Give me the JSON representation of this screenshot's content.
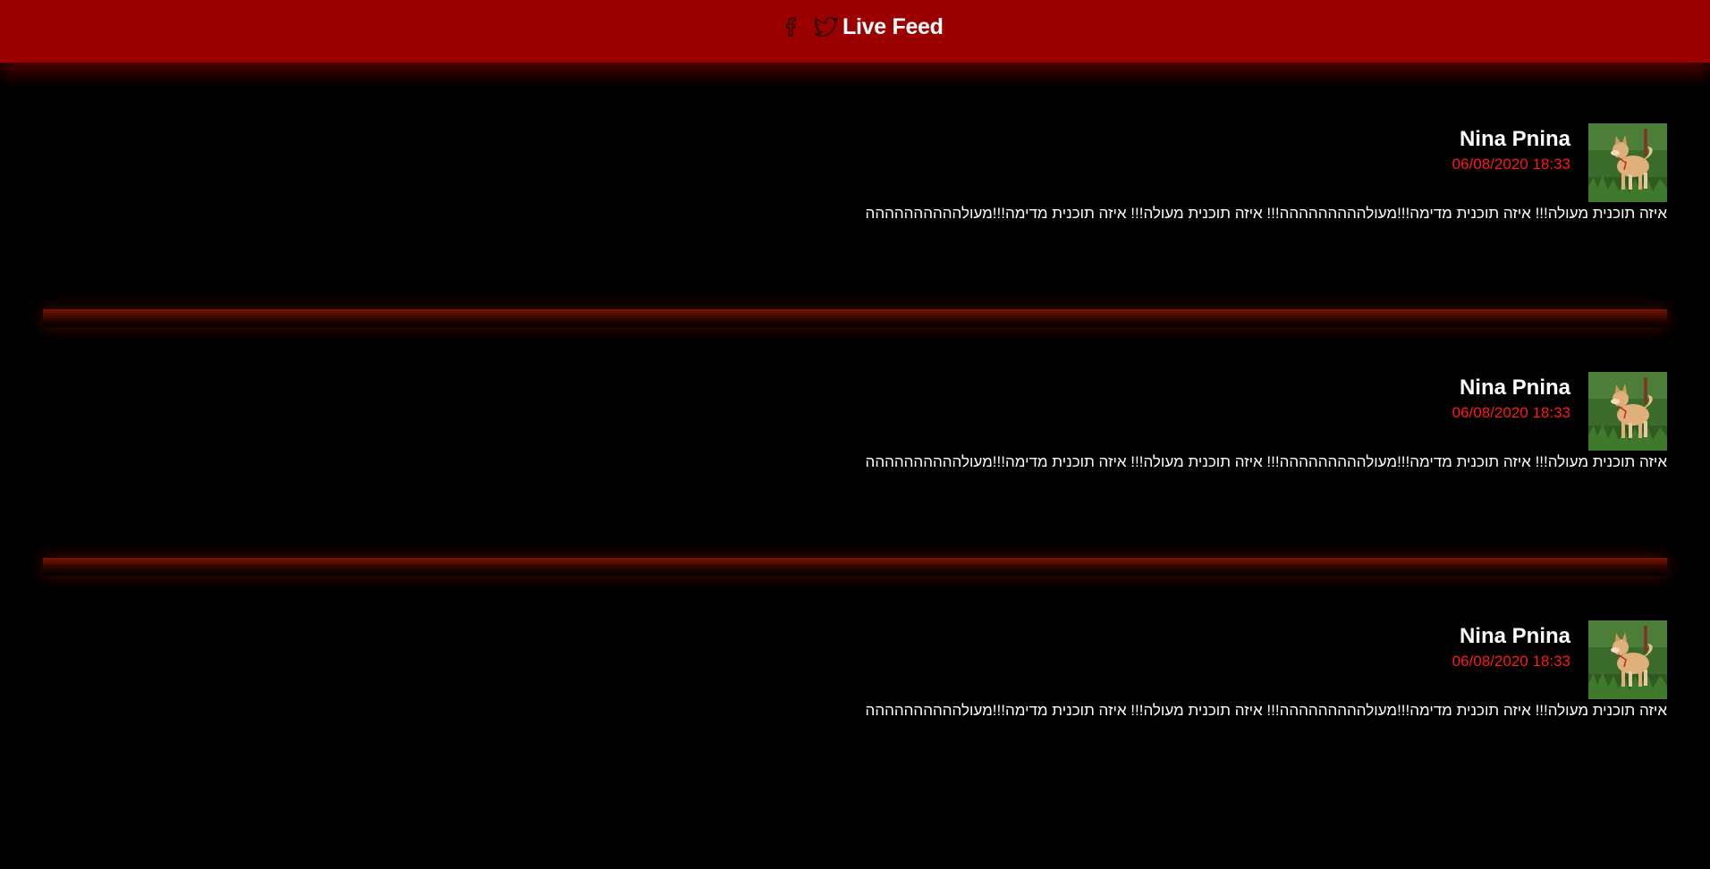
{
  "header": {
    "title": "Live Feed",
    "icons": [
      "facebook-icon",
      "twitter-icon"
    ],
    "background_color": "#9b0000"
  },
  "colors": {
    "page_background": "#000000",
    "timestamp": "#ff1a1a",
    "text": "#ffffff"
  },
  "posts": [
    {
      "author": "Nina Pnina",
      "time": "06/08/2020 18:33",
      "text": "איזה תוכנית מעולה!!! איזה תוכנית מדימה!!!מעולההההההההה!!! איזה תוכנית מעולה!!! איזה תוכנית מדימה!!!מעולהההההההההה",
      "avatar": "dog-photo"
    },
    {
      "author": "Nina Pnina",
      "time": "06/08/2020 18:33",
      "text": "איזה תוכנית מעולה!!! איזה תוכנית מדימה!!!מעולההההההההה!!! איזה תוכנית מעולה!!! איזה תוכנית מדימה!!!מעולהההההההההה",
      "avatar": "dog-photo"
    },
    {
      "author": "Nina Pnina",
      "time": "06/08/2020 18:33",
      "text": "איזה תוכנית מעולה!!! איזה תוכנית מדימה!!!מעולההההההההה!!! איזה תוכנית מעולה!!! איזה תוכנית מדימה!!!מעולהההההההההה",
      "avatar": "dog-photo"
    }
  ]
}
